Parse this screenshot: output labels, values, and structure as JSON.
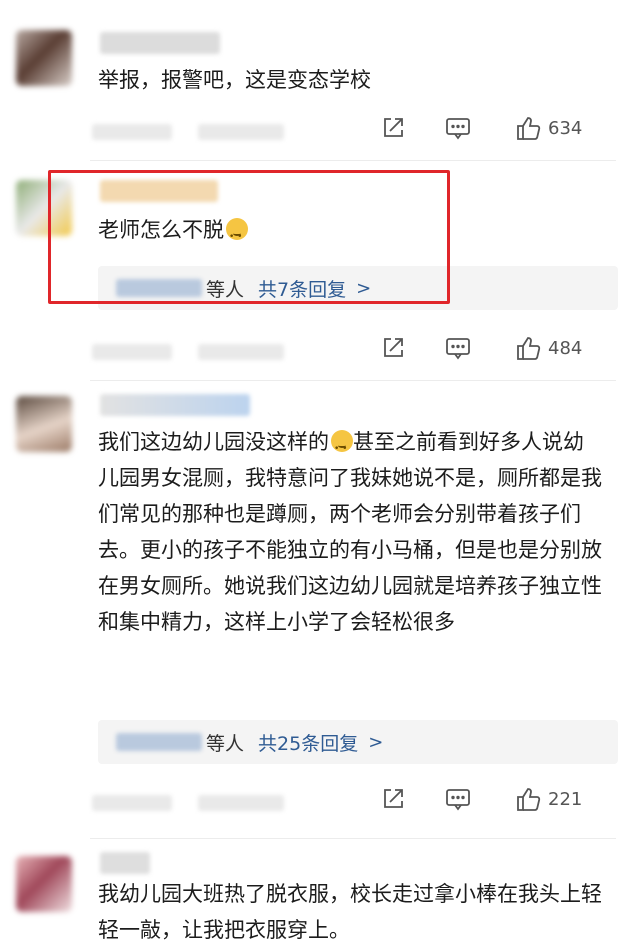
{
  "comments": [
    {
      "text": "举报，报警吧，这是变态学校",
      "likes": "634"
    },
    {
      "text": "老师怎么不脱",
      "emoji": "smile-emoji",
      "reply_suffix": "等人",
      "reply_count": "共7条回复",
      "chevron": ">",
      "likes": "484"
    },
    {
      "text": "我们这边幼儿园没这样的",
      "emoji": "laugh-cry-emoji",
      "text_rest": "甚至之前看到好多人说幼儿园男女混厕，我特意问了我妹她说不是，厕所都是我们常见的那种也是蹲厕，两个老师会分别带着孩子们去。更小的孩子不能独立的有小马桶，但是也是分别放在男女厕所。她说我们这边幼儿园就是培养孩子独立性和集中精力，这样上小学了会轻松很多",
      "reply_suffix": "等人",
      "reply_count": "共25条回复",
      "chevron": ">",
      "likes": "221"
    },
    {
      "text": "我幼儿园大班热了脱衣服，校长走过拿小棒在我头上轻轻一敲，让我把衣服穿上。"
    }
  ],
  "colors": {
    "highlight": "#e0262a",
    "reply_link": "#2f5b93"
  },
  "icons": [
    "share-icon",
    "comment-icon",
    "like-icon"
  ]
}
